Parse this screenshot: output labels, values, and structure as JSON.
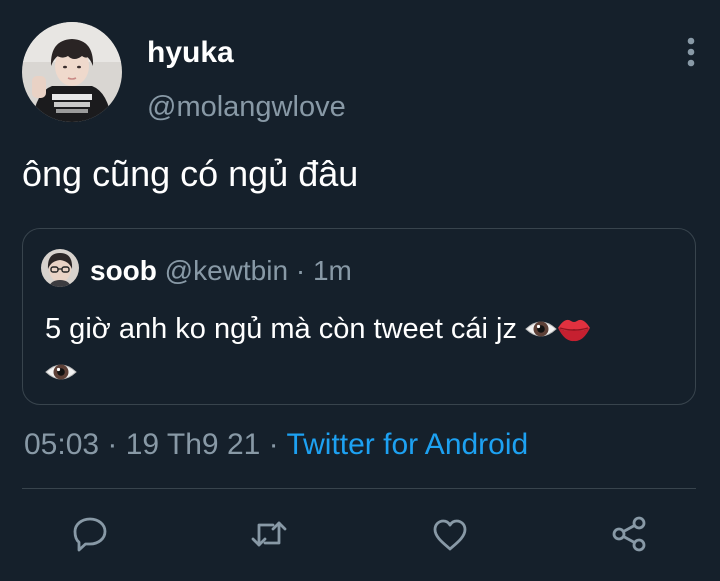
{
  "tweet": {
    "author": {
      "display_name": "hyuka",
      "handle": "@molangwlove",
      "avatar_icon": "profile-photo"
    },
    "text": "ông cũng có ngủ đâu",
    "quoted": {
      "display_name": "soob",
      "handle": "@kewtbin",
      "separator": " · ",
      "time": "1m",
      "text": "5 giờ anh ko ngủ mà còn tweet cái jz",
      "emojis": [
        "eye-emoji",
        "lips-emoji",
        "eye-emoji"
      ]
    },
    "meta": {
      "time": "05:03",
      "sep1": " · ",
      "date": "19 Th9 21",
      "sep2": " · ",
      "source": "Twitter for Android"
    }
  },
  "actions": [
    {
      "icon": "reply-icon"
    },
    {
      "icon": "retweet-icon"
    },
    {
      "icon": "like-icon"
    },
    {
      "icon": "share-icon"
    }
  ],
  "colors": {
    "background": "#15202b",
    "text": "#ffffff",
    "secondary": "#8899a6",
    "link": "#1da1f2",
    "border": "#38444d"
  }
}
